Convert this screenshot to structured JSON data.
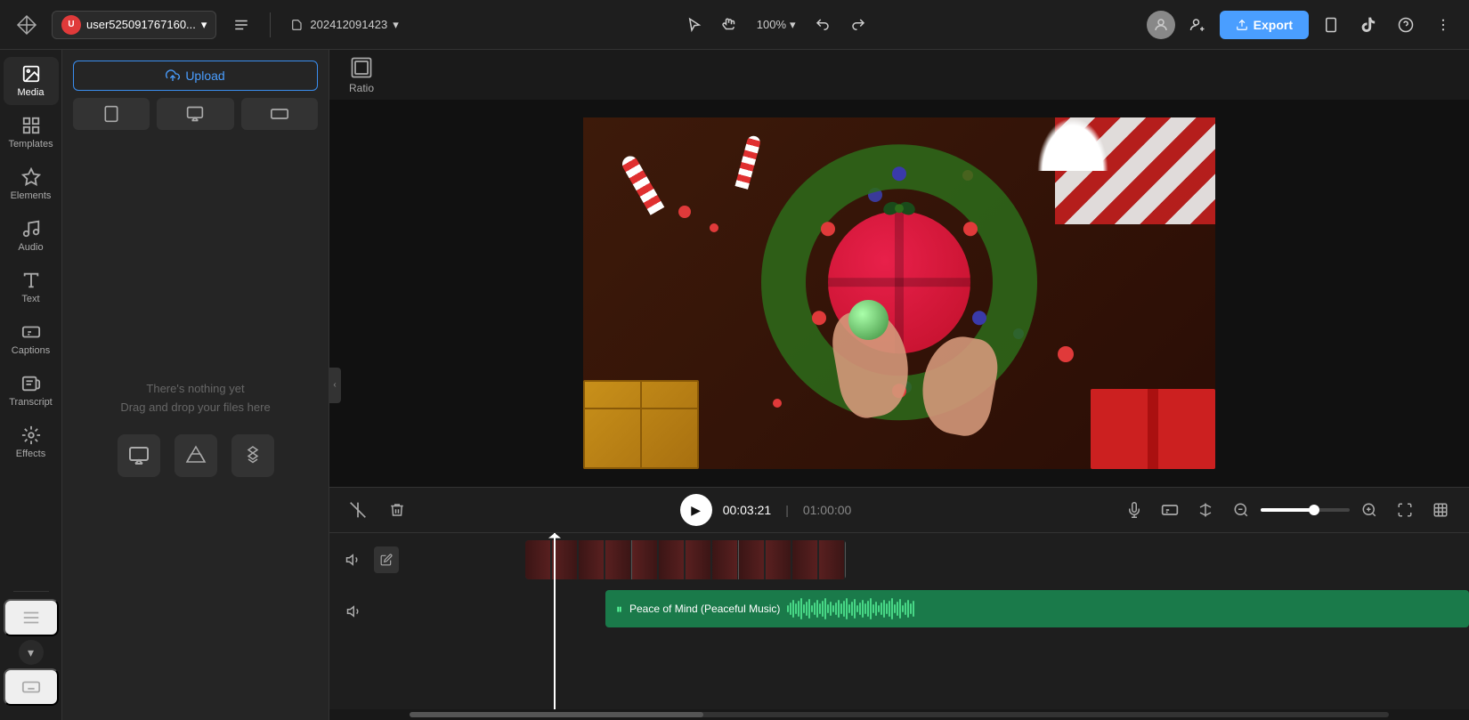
{
  "topbar": {
    "logo_text": "✦",
    "user_label": "user525091767160...",
    "user_initial": "U",
    "project_id": "202412091423",
    "zoom_level": "100%",
    "export_label": "Export",
    "undo_title": "Undo",
    "redo_title": "Redo"
  },
  "sidebar": {
    "items": [
      {
        "id": "media",
        "label": "Media",
        "active": true
      },
      {
        "id": "templates",
        "label": "Templates",
        "active": false
      },
      {
        "id": "elements",
        "label": "Elements",
        "active": false
      },
      {
        "id": "audio",
        "label": "Audio",
        "active": false
      },
      {
        "id": "text",
        "label": "Text",
        "active": false
      },
      {
        "id": "captions",
        "label": "Captions",
        "active": false
      },
      {
        "id": "transcript",
        "label": "Transcript",
        "active": false
      },
      {
        "id": "effects",
        "label": "Effects",
        "active": false
      }
    ]
  },
  "panel": {
    "upload_label": "Upload",
    "empty_text_line1": "There's nothing yet",
    "empty_text_line2": "Drag and drop your files here",
    "format_buttons": [
      "tablet",
      "monitor",
      "widescreen"
    ]
  },
  "ratio": {
    "label": "Ratio"
  },
  "playback": {
    "current_time": "00:03:21",
    "total_time": "01:00:00",
    "play_label": "▶"
  },
  "timeline": {
    "track1_vol": "🔊",
    "track2_vol": "🔊",
    "audio_label": "Peace of Mind (Peaceful Music)"
  }
}
